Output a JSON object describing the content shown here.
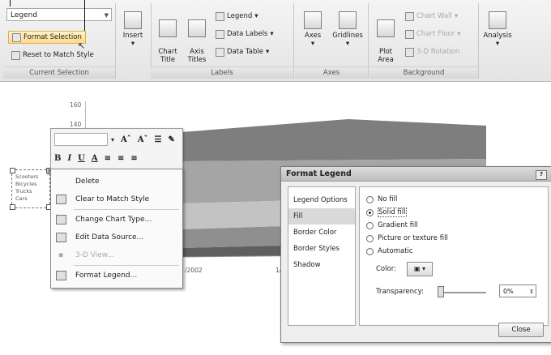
{
  "ribbon": {
    "current_selection": {
      "element_combo": "Legend",
      "format_selection": "Format Selection",
      "reset_to_match": "Reset to Match Style",
      "label": "Current Selection"
    },
    "insert": {
      "label": "Insert"
    },
    "labels_group": {
      "chart_title": "Chart\nTitle",
      "axis_titles": "Axis\nTitles",
      "legend": "Legend",
      "data_labels": "Data Labels",
      "data_table": "Data Table",
      "label": "Labels"
    },
    "axes_group": {
      "axes": "Axes",
      "gridlines": "Gridlines",
      "label": "Axes"
    },
    "background_group": {
      "plot_area": "Plot\nArea",
      "chart_wall": "Chart Wall",
      "chart_floor": "Chart Floor",
      "rotation": "3-D Rotation",
      "label": "Background"
    },
    "analysis": {
      "label": "Analysis"
    }
  },
  "chart": {
    "axis_ticks": [
      "160",
      "140"
    ],
    "x_ticks": [
      "/2002",
      "1/"
    ],
    "legend_entries": [
      "Scooters",
      "Bicycles",
      "Trucks",
      "Cars"
    ],
    "series_colors": [
      "#7e7e7e",
      "#a5a5a5",
      "#c3c3c3",
      "#8f8f8f",
      "#5f5f5f"
    ]
  },
  "mini_toolbar": {
    "grow": "Aˆ",
    "shrink": "Aˇ",
    "list": "☰",
    "bold": "B",
    "italic": "I",
    "underline": "U",
    "fontcolor": "A"
  },
  "context_menu": {
    "items": [
      "Delete",
      "Clear to Match Style",
      "Change Chart Type...",
      "Edit Data Source...",
      "3-D View...",
      "Format Legend..."
    ]
  },
  "dialog": {
    "title": "Format Legend",
    "categories": [
      "Legend Options",
      "Fill",
      "Border Color",
      "Border Styles",
      "Shadow"
    ],
    "selected_category": "Fill",
    "fill_options": [
      "No fill",
      "Solid fill",
      "Gradient fill",
      "Picture or texture fill",
      "Automatic"
    ],
    "selected_fill": "Solid fill",
    "color_label": "Color:",
    "transparency_label": "Transparency:",
    "transparency_value": "0%",
    "close_label": "Close"
  }
}
